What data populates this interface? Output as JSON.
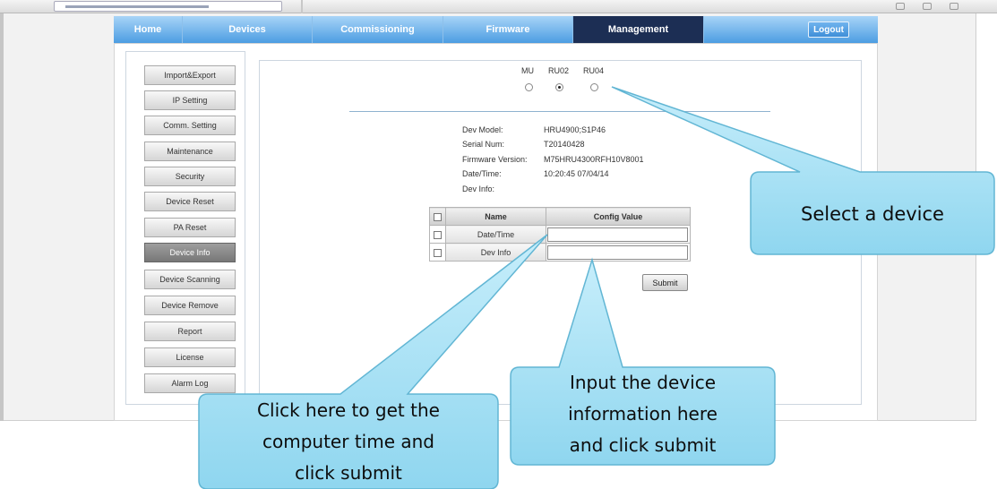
{
  "nav": {
    "items": [
      "Home",
      "Devices",
      "Commissioning",
      "Firmware",
      "Management"
    ],
    "active": "Management",
    "logout_label": "Logout"
  },
  "sidebar": {
    "items": [
      {
        "label": "Import&Export"
      },
      {
        "label": "IP Setting"
      },
      {
        "label": "Comm. Setting"
      },
      {
        "label": "Maintenance"
      },
      {
        "label": "Security"
      },
      {
        "label": "Device Reset"
      },
      {
        "label": "PA Reset"
      },
      {
        "label": "Device Info",
        "active": true
      },
      {
        "label": "Device Scanning"
      },
      {
        "label": "Device Remove"
      },
      {
        "label": "Report"
      },
      {
        "label": "License"
      },
      {
        "label": "Alarm Log"
      }
    ]
  },
  "device_selector": {
    "devices": [
      "MU",
      "RU02",
      "RU04"
    ],
    "selected": "RU02"
  },
  "device_info": {
    "model_label": "Dev Model:",
    "model_value": "HRU4900;S1P46",
    "serial_label": "Serial Num:",
    "serial_value": "T20140428",
    "firmware_label": "Firmware Version:",
    "firmware_value": "M75HRU4300RFH10V8001",
    "datetime_label": "Date/Time:",
    "datetime_value": "10:20:45 07/04/14",
    "devinfo_label": "Dev Info:",
    "devinfo_value": ""
  },
  "config_table": {
    "headers": [
      "Name",
      "Config Value"
    ],
    "rows": [
      {
        "name": "Date/Time",
        "value": ""
      },
      {
        "name": "Dev Info",
        "value": ""
      }
    ],
    "submit_label": "Submit"
  },
  "callouts": {
    "select_device": "Select a device",
    "computer_time": [
      "Click here to get the",
      "computer time and",
      "click submit"
    ],
    "input_info": [
      "Input the device",
      "information here",
      "and click submit"
    ]
  },
  "colors": {
    "nav_gradient_top": "#a8d4f7",
    "nav_gradient_bottom": "#4c9de2",
    "nav_active": "#1c2e54",
    "callout_fill": "#a9e3f5",
    "callout_stroke": "#62b6d4"
  }
}
